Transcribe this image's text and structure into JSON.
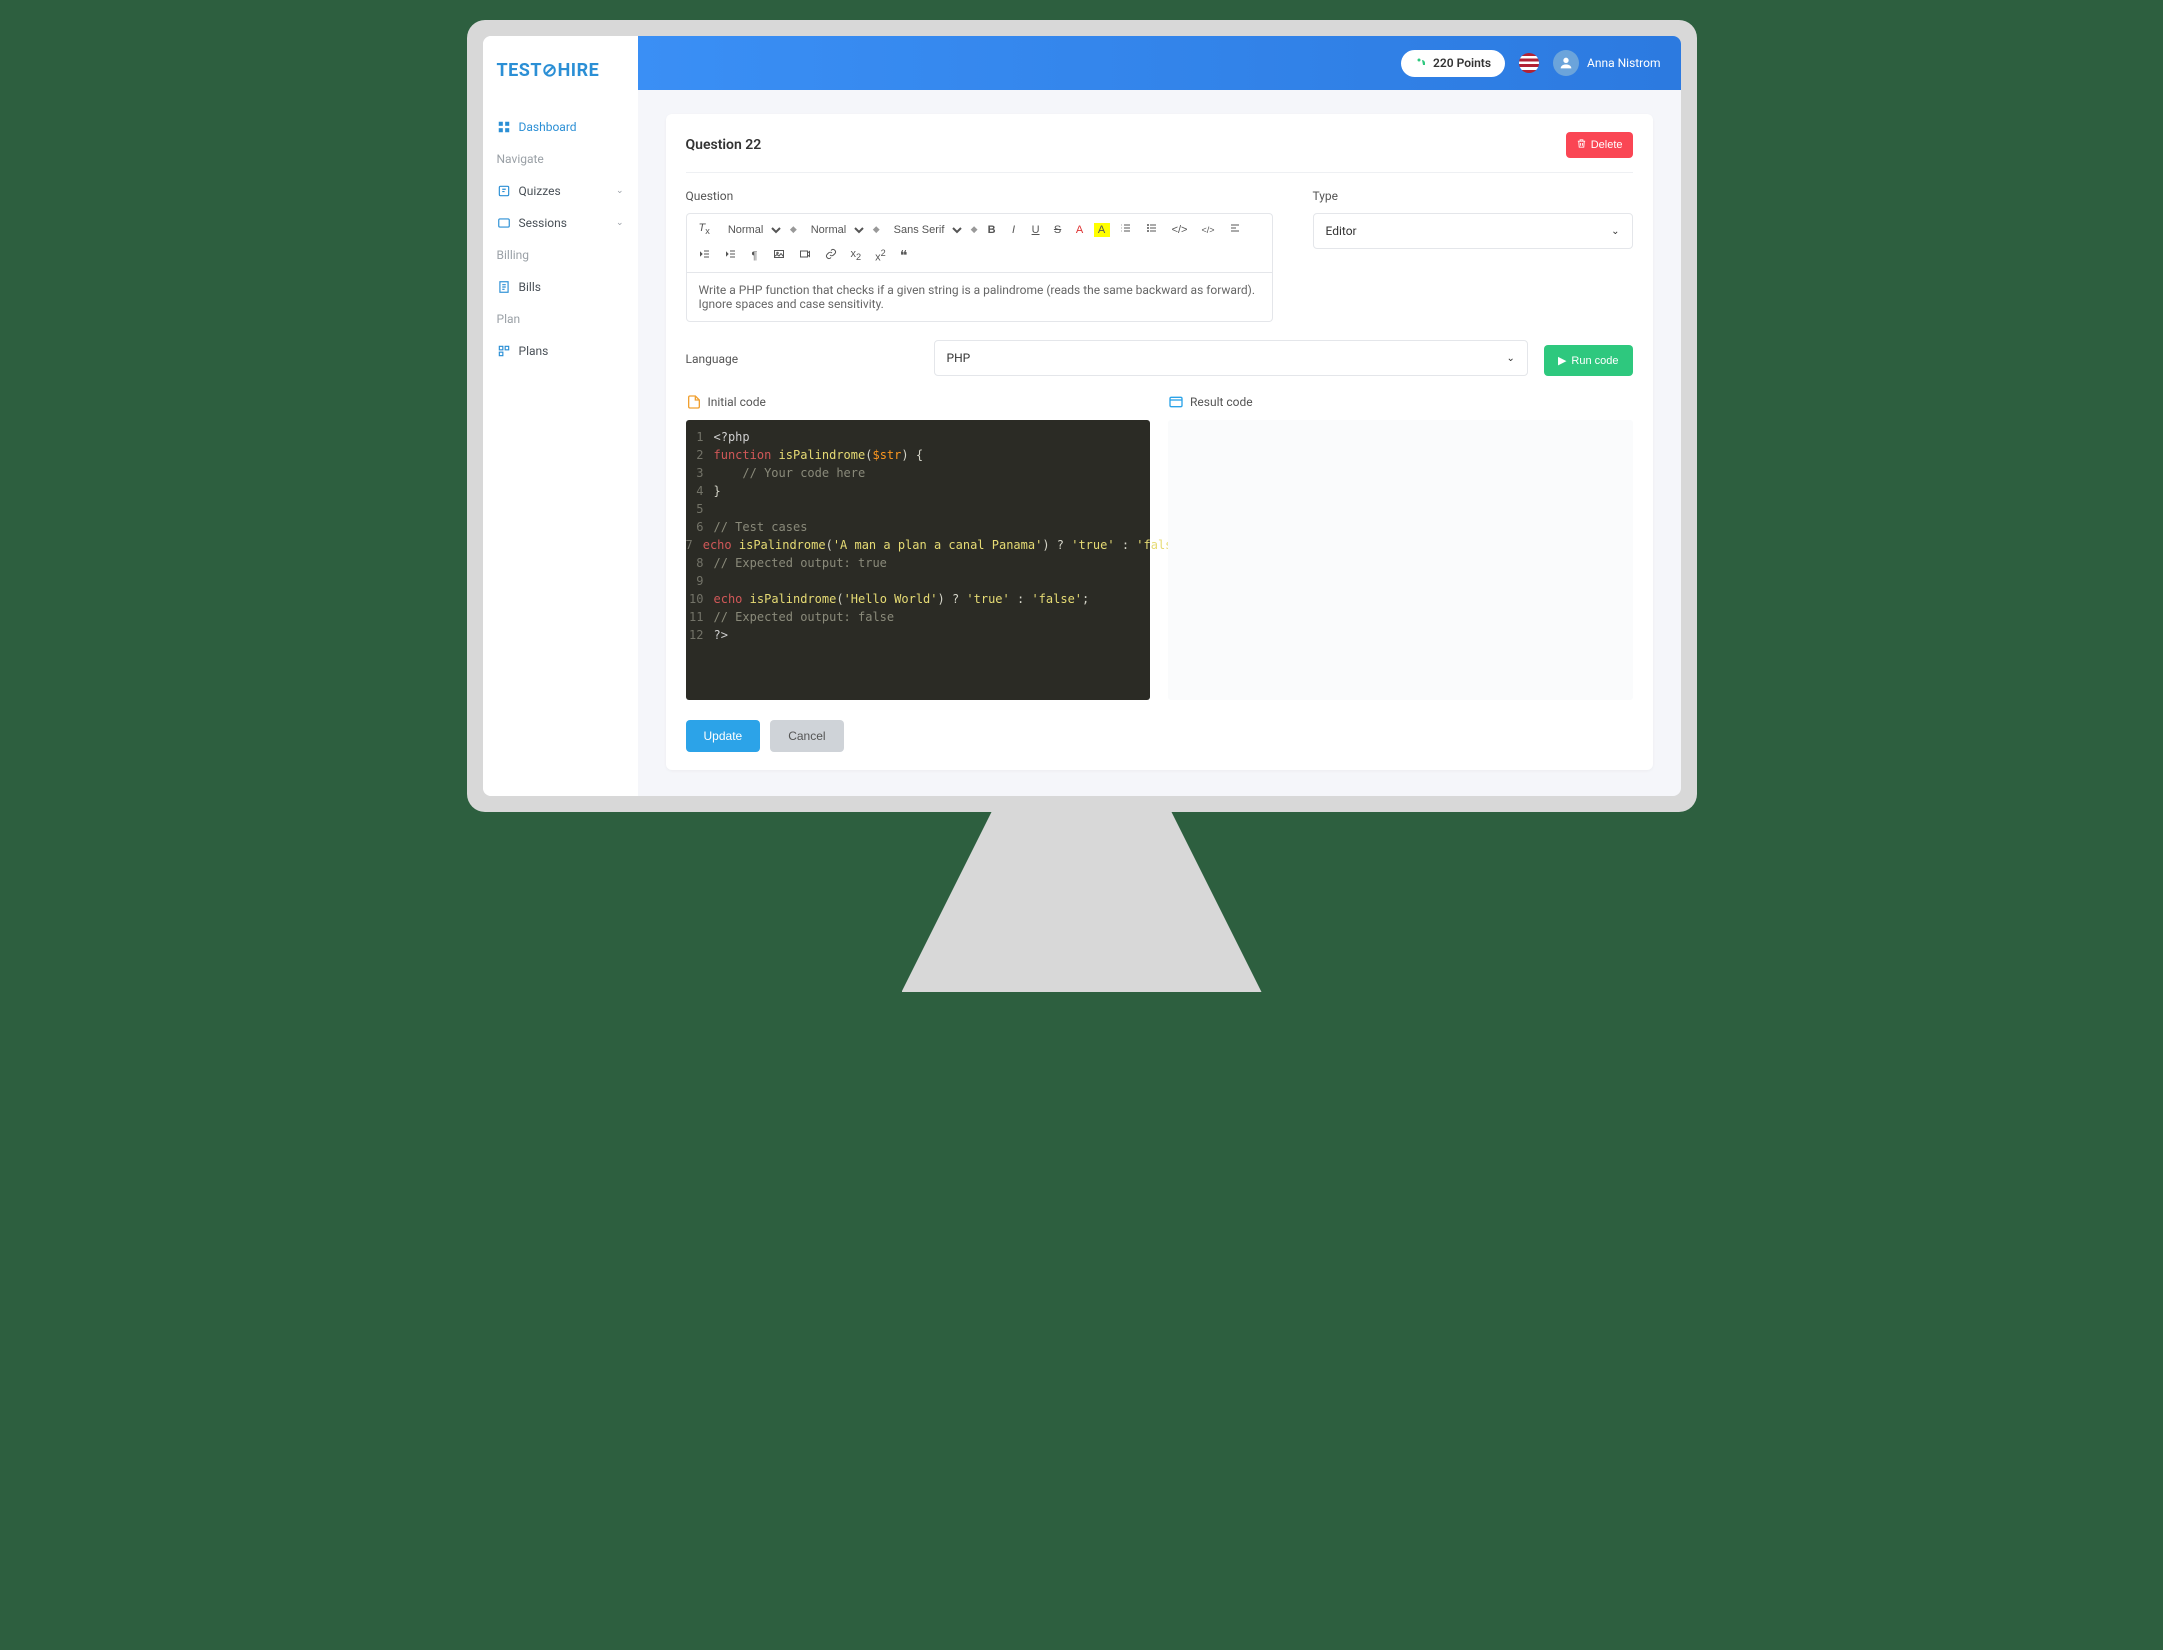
{
  "logo": "TEST⊘HIRE",
  "topbar": {
    "points_label": "220 Points",
    "username": "Anna Nistrom"
  },
  "sidebar": {
    "dashboard": "Dashboard",
    "navigate": "Navigate",
    "quizzes": "Quizzes",
    "sessions": "Sessions",
    "billing": "Billing",
    "bills": "Bills",
    "plan": "Plan",
    "plans": "Plans"
  },
  "question": {
    "title": "Question 22",
    "delete_label": "Delete",
    "question_label": "Question",
    "type_label": "Type",
    "type_value": "Editor",
    "prompt": "Write a PHP function that checks if a given string is a palindrome (reads the same backward as forward). Ignore spaces and case sensitivity.",
    "language_label": "Language",
    "language_value": "PHP",
    "run_label": "Run code",
    "initial_label": "Initial code",
    "result_label": "Result code"
  },
  "toolbar": {
    "normal1": "Normal",
    "normal2": "Normal",
    "sans": "Sans Serif"
  },
  "code": {
    "lines": [
      "<?php",
      "function isPalindrome($str) {",
      "    // Your code here",
      "}",
      "",
      "// Test cases",
      "echo isPalindrome('A man a plan a canal Panama') ? 'true' : 'false';",
      "// Expected output: true",
      "",
      "echo isPalindrome('Hello World') ? 'true' : 'false';",
      "// Expected output: false",
      "?>"
    ]
  },
  "actions": {
    "update": "Update",
    "cancel": "Cancel"
  }
}
